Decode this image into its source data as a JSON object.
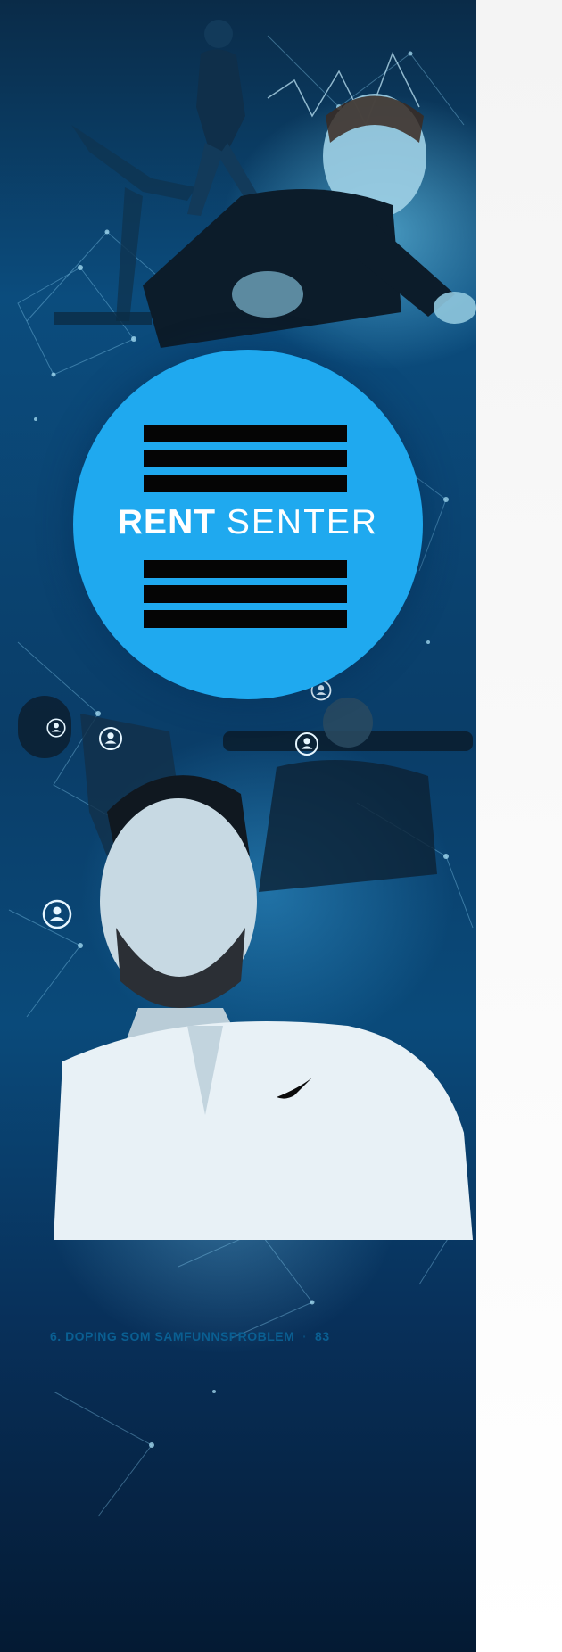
{
  "page": {
    "logo": {
      "bold": "RENT",
      "light": "SENTER"
    },
    "footer": {
      "chapter": "6. DOPING SOM SAMFUNNSPROBLEM",
      "page_number": "83"
    }
  },
  "icons": [
    "network-node-icon",
    "user-node-icon"
  ],
  "colors": {
    "logo_circle": "#1fa9ef",
    "stripes": "#050505",
    "footer_text": "#0a5f92"
  }
}
